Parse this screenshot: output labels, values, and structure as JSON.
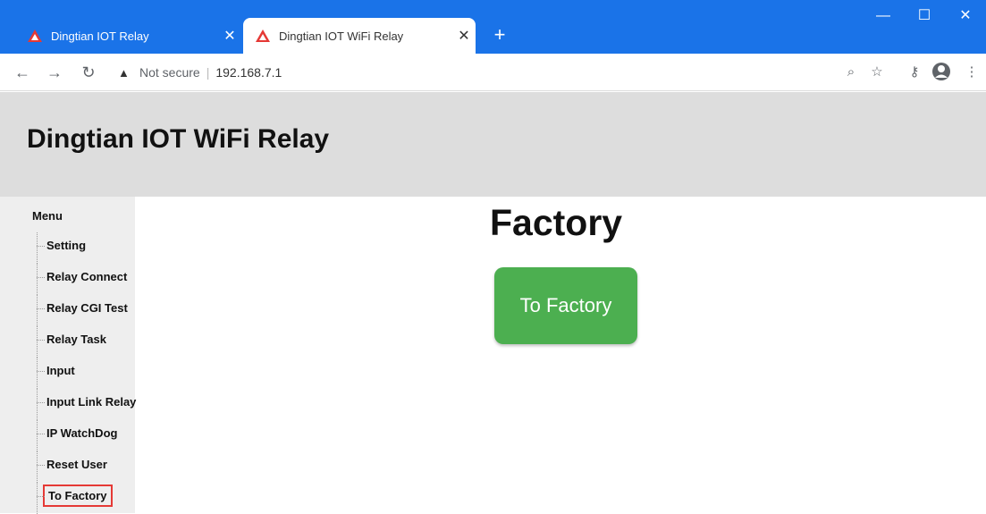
{
  "browser": {
    "tabs": [
      {
        "title": "Dingtian IOT Relay",
        "active": false
      },
      {
        "title": "Dingtian IOT WiFi Relay",
        "active": true
      }
    ],
    "new_tab": "+",
    "tab_close": "✕",
    "window_controls": {
      "minimize": "—",
      "maximize": "☐",
      "close": "✕"
    },
    "address": {
      "security_label": "Not secure",
      "url": "192.168.7.1"
    },
    "icons": [
      "back-arrow-icon",
      "forward-arrow-icon",
      "reload-icon",
      "zoom-icon",
      "star-icon",
      "key-icon",
      "profile-icon",
      "menu-dots-icon"
    ],
    "accent_color": "#1a73e8"
  },
  "page": {
    "header_title": "Dingtian IOT WiFi Relay",
    "menu_title": "Menu",
    "menu_items": [
      "Setting",
      "Relay Connect",
      "Relay CGI Test",
      "Relay Task",
      "Input",
      "Input Link Relay",
      "IP WatchDog",
      "Reset User",
      "To Factory"
    ],
    "selected_menu_item": "To Factory",
    "main_title": "Factory",
    "action_button": "To Factory",
    "button_color": "#4caf50"
  }
}
